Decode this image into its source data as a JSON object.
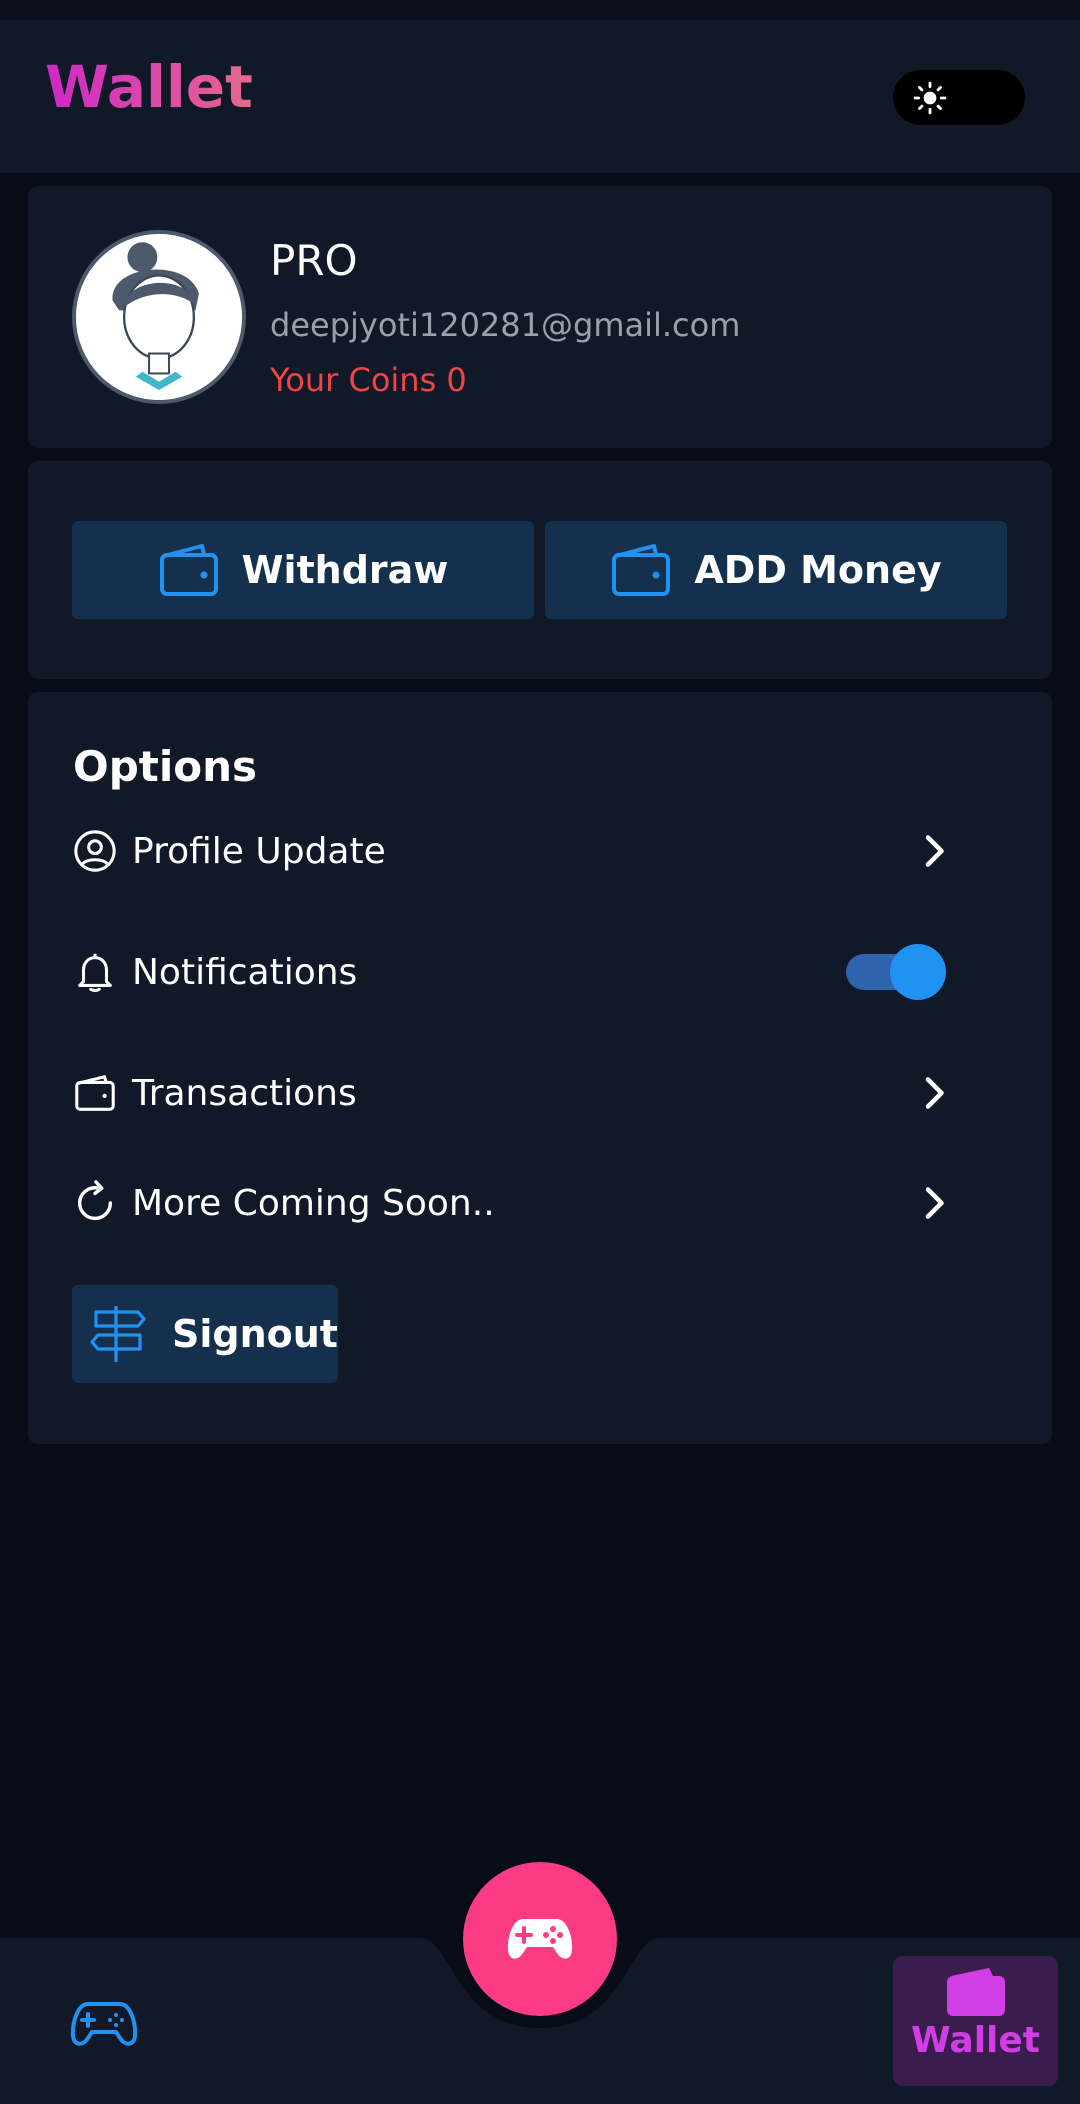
{
  "header": {
    "title": "Wallet",
    "theme_toggle_icon": "sun-icon",
    "title_gradient": [
      "#d027c8",
      "#e46a8d"
    ]
  },
  "profile": {
    "name": "PRO",
    "email": "deepjyoti120281@gmail.com",
    "coins_text": "Your Coins 0",
    "coins_color": "#ef4444"
  },
  "actions": {
    "withdraw_label": "Withdraw",
    "add_money_label": "ADD Money",
    "icon": "wallet-icon",
    "accent": "#2093f2"
  },
  "options": {
    "title": "Options",
    "items": [
      {
        "label": "Profile Update",
        "icon": "user-circle-icon",
        "control": "chevron"
      },
      {
        "label": "Notifications",
        "icon": "bell-icon",
        "control": "switch",
        "switch_on": true
      },
      {
        "label": "Transactions",
        "icon": "wallet-icon",
        "control": "chevron"
      },
      {
        "label": "More Coming Soon..",
        "icon": "refresh-icon",
        "control": "chevron"
      }
    ],
    "signout_label": "Signout",
    "signout_icon": "signpost-icon"
  },
  "bottom_nav": {
    "left_icon": "gamepad-icon",
    "center_icon": "gamepad-icon",
    "center_color": "#fd3a84",
    "active_label": "Wallet",
    "active_icon": "wallet-icon",
    "active_color": "#d13ee6"
  }
}
